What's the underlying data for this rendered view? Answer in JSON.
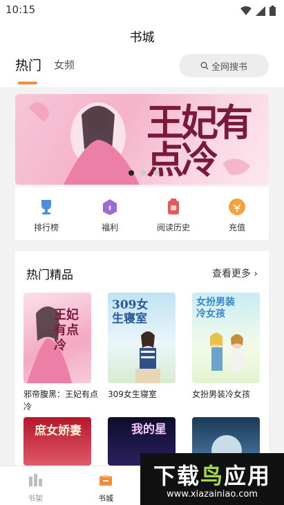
{
  "status_bar": {
    "time": "10:15"
  },
  "header": {
    "title": "书城",
    "tabs": [
      {
        "label": "热门",
        "active": true
      },
      {
        "label": "女频",
        "active": false
      }
    ],
    "search": {
      "placeholder": "全网搜书",
      "icon": "search-icon"
    }
  },
  "banner": {
    "title": "王妃有点冷",
    "dots_count": 3,
    "active_index": 0
  },
  "quick_links": [
    {
      "label": "排行榜",
      "icon": "trophy-icon",
      "color": "#4b8fd8"
    },
    {
      "label": "福利",
      "icon": "gift-icon",
      "color": "#9a6bd6"
    },
    {
      "label": "阅读历史",
      "icon": "history-icon",
      "color": "#e65a5a"
    },
    {
      "label": "充值",
      "icon": "recharge-icon",
      "color": "#f3a23c"
    }
  ],
  "section": {
    "title": "热门精品",
    "more_label": "查看更多",
    "books": [
      {
        "title": "邪帝腹黑：王妃有点冷",
        "cover_text": "王妃有点冷"
      },
      {
        "title": "309女生寝室",
        "cover_text": "309女生寝室"
      },
      {
        "title": "女扮男装冷女孩",
        "cover_text": "女扮男装冷女孩"
      },
      {
        "title": "",
        "cover_text": "庶女娇妻"
      },
      {
        "title": "",
        "cover_text": "我的星"
      },
      {
        "title": "",
        "cover_text": ""
      }
    ]
  },
  "bottom_nav": [
    {
      "label": "书架",
      "icon": "bookshelf-icon",
      "active": false
    },
    {
      "label": "书城",
      "icon": "bookstore-icon",
      "active": true
    }
  ],
  "watermark": {
    "main_prefix": "下载",
    "main_accent": "鸟",
    "main_suffix": "应用",
    "url": "www.xiazainiao.com"
  },
  "colors": {
    "accent": "#f28c38",
    "nav_inactive": "#999999",
    "nav_active": "#222222"
  }
}
